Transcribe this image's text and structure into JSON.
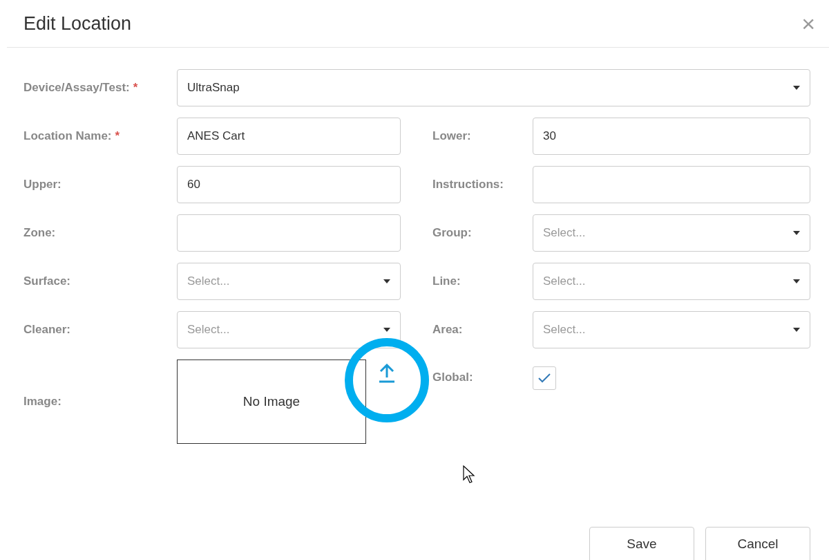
{
  "dialog": {
    "title": "Edit Location",
    "close": "×"
  },
  "primary_field": {
    "label": "Device/Assay/Test:",
    "required_mark": "*",
    "kind": "select",
    "value": "UltraSnap"
  },
  "rows": [
    {
      "left": {
        "label": "Location Name:",
        "required_mark": "*",
        "kind": "text",
        "value": "ANES Cart"
      },
      "right": {
        "label": "Lower:",
        "kind": "text",
        "value": "30"
      }
    },
    {
      "left": {
        "label": "Upper:",
        "kind": "text",
        "value": "60"
      },
      "right": {
        "label": "Instructions:",
        "kind": "text"
      }
    },
    {
      "left": {
        "label": "Zone:",
        "kind": "text"
      },
      "right": {
        "label": "Group:",
        "kind": "select",
        "placeholder": "Select..."
      }
    },
    {
      "left": {
        "label": "Surface:",
        "kind": "select",
        "placeholder": "Select..."
      },
      "right": {
        "label": "Line:",
        "kind": "select",
        "placeholder": "Select..."
      }
    },
    {
      "left": {
        "label": "Cleaner:",
        "kind": "select",
        "placeholder": "Select..."
      },
      "right": {
        "label": "Area:",
        "kind": "select",
        "placeholder": "Select..."
      }
    }
  ],
  "image_field": {
    "label": "Image:",
    "empty_text": "No Image",
    "upload_highlighted": true
  },
  "global_field": {
    "label": "Global:",
    "checked": true
  },
  "buttons": [
    "Save",
    "Cancel"
  ]
}
